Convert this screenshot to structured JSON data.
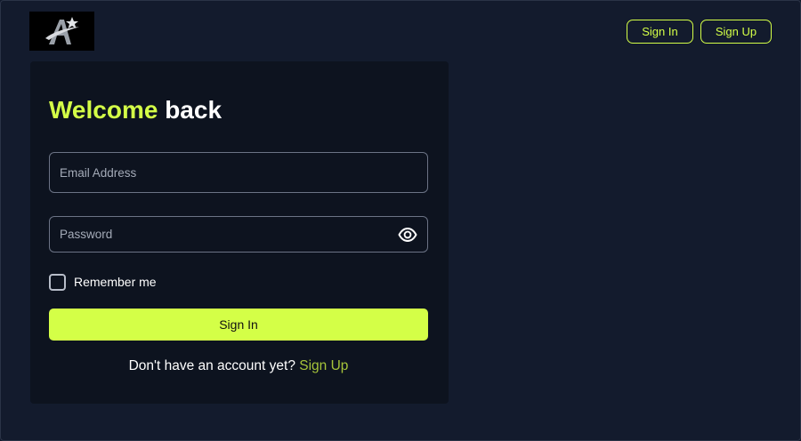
{
  "header": {
    "logo_icon": "star-a-logo",
    "sign_in_label": "Sign In",
    "sign_up_label": "Sign Up"
  },
  "login": {
    "title_accent": "Welcome",
    "title_rest": " back",
    "email": {
      "placeholder": "Email Address",
      "value": ""
    },
    "password": {
      "placeholder": "Password",
      "value": "",
      "toggle_icon": "eye-icon"
    },
    "remember_label": "Remember me",
    "remember_checked": false,
    "submit_label": "Sign In",
    "footer_prompt": "Don't have an account yet? ",
    "footer_link": "Sign Up"
  },
  "colors": {
    "accent": "#d4ff47",
    "page_bg": "#131b2d",
    "card_bg": "#0d131f",
    "link": "#a6c43a"
  }
}
